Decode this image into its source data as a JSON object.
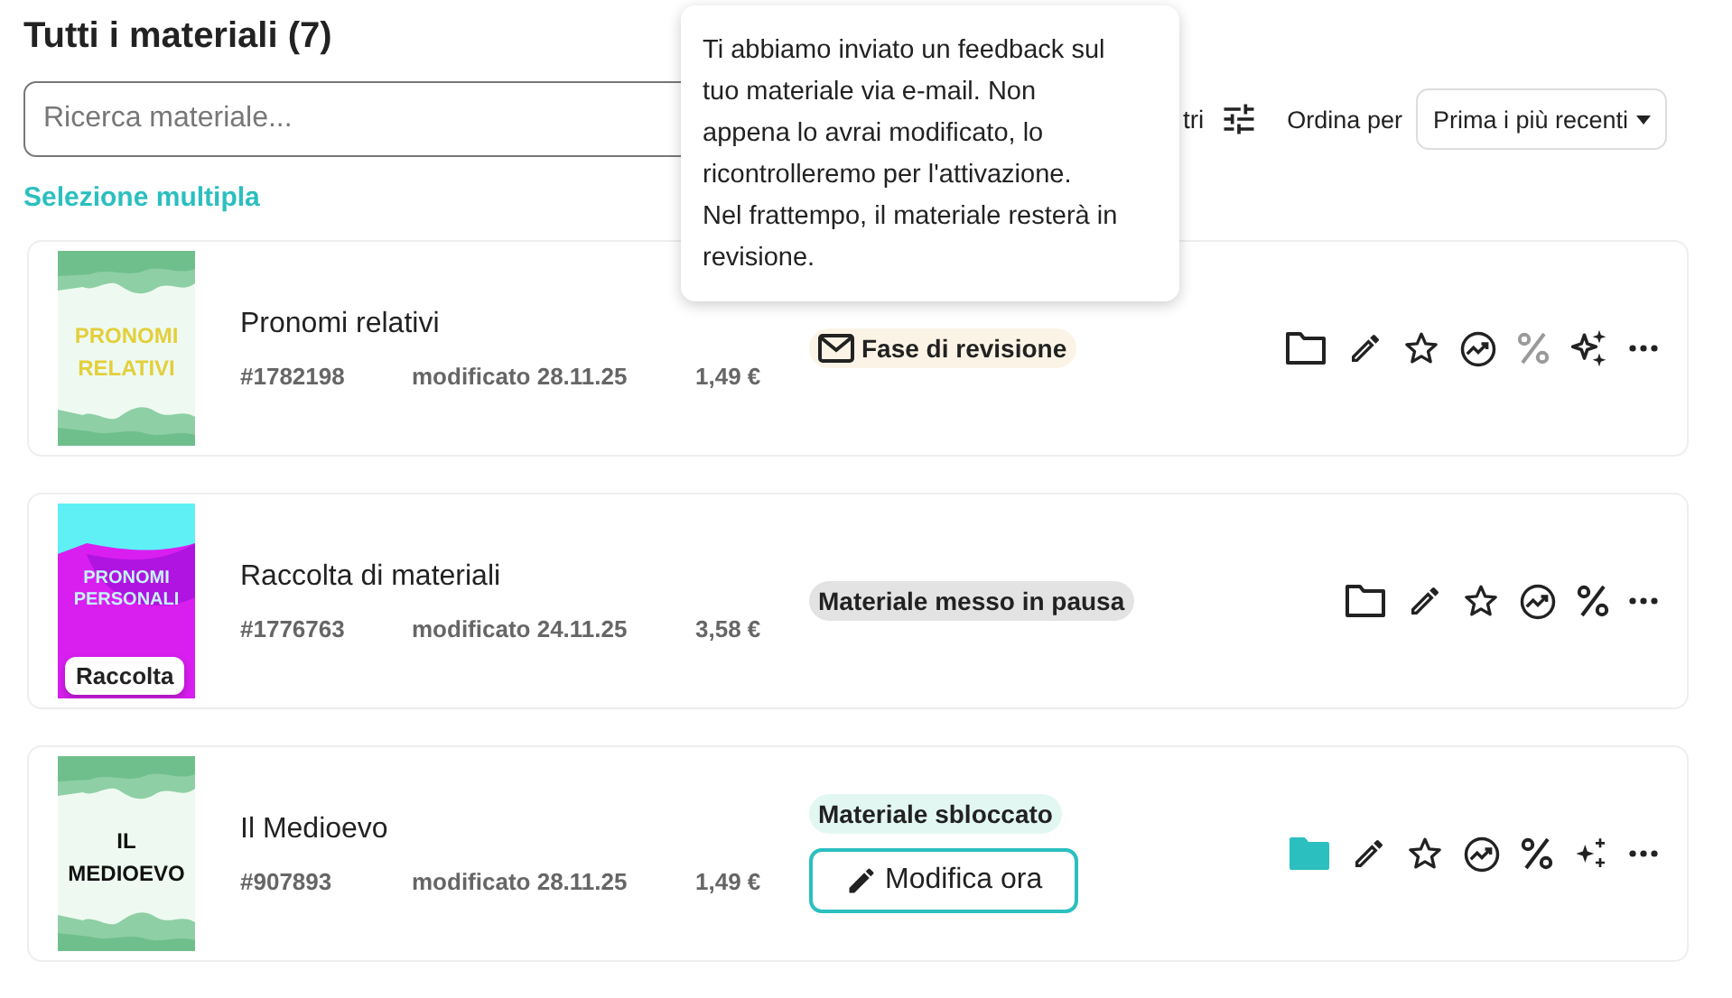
{
  "title": "Tutti i materiali (7)",
  "search": {
    "placeholder": "Ricerca materiale..."
  },
  "filter": {
    "label": "tri"
  },
  "sort": {
    "label": "Ordina per",
    "value": "Prima i più recenti"
  },
  "multi_select": "Selezione multipla",
  "tooltip": "Ti abbiamo inviato un feedback sul tuo materiale via e-mail. Non appena lo avrai modificato, lo ricontrolleremo per l'attivazione. Nel frattempo, il materiale resterà in revisione.",
  "materials": [
    {
      "cover": {
        "kind": "green-gold",
        "lines": [
          "PRONOMI",
          "RELATIVI"
        ]
      },
      "title": "Pronomi relativi",
      "id": "#1782198",
      "modified": "modificato 28.11.25",
      "price": "1,49 €",
      "status": {
        "kind": "review",
        "label": "Fase di revisione"
      },
      "actions": [
        {
          "kind": "folder",
          "filled": false
        },
        {
          "kind": "edit"
        },
        {
          "kind": "star"
        },
        {
          "kind": "stats"
        },
        {
          "kind": "percent",
          "disabled": true
        },
        {
          "kind": "sparkles-solid"
        },
        {
          "kind": "more"
        }
      ]
    },
    {
      "cover": {
        "kind": "magenta",
        "lines": [
          "PRONOMI",
          "PERSONALI"
        ],
        "badge": "Raccolta"
      },
      "title": "Raccolta di materiali",
      "id": "#1776763",
      "modified": "modificato 24.11.25",
      "price": "3,58 €",
      "status": {
        "kind": "paused",
        "label": "Materiale messo in pausa"
      },
      "actions": [
        {
          "kind": "folder",
          "filled": false
        },
        {
          "kind": "edit"
        },
        {
          "kind": "star"
        },
        {
          "kind": "stats"
        },
        {
          "kind": "percent",
          "disabled": false
        },
        {
          "kind": "more"
        }
      ]
    },
    {
      "cover": {
        "kind": "green-ink",
        "lines": [
          "IL",
          "MEDIOEVO"
        ]
      },
      "title": "Il Medioevo",
      "id": "#907893",
      "modified": "modificato 28.11.25",
      "price": "1,49 €",
      "status": {
        "kind": "unlocked",
        "label": "Materiale sbloccato",
        "button": "Modifica ora"
      },
      "actions": [
        {
          "kind": "folder",
          "filled": true
        },
        {
          "kind": "edit"
        },
        {
          "kind": "star"
        },
        {
          "kind": "stats"
        },
        {
          "kind": "percent",
          "disabled": false
        },
        {
          "kind": "sparkles-outline"
        },
        {
          "kind": "more"
        }
      ]
    }
  ]
}
